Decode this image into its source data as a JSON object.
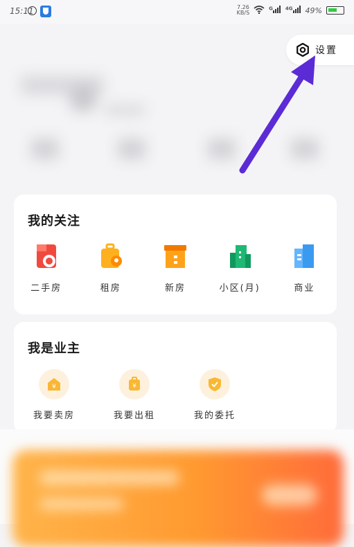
{
  "status_bar": {
    "time": "15:11",
    "net_speed_value": "7.26",
    "net_speed_unit": "KB/S",
    "signal1_label": "G",
    "signal2_label": "4G",
    "battery": "49%"
  },
  "settings": {
    "label": "设置"
  },
  "follow_card": {
    "title": "我的关注",
    "items": [
      {
        "label": "二手房",
        "icon": "second-hand-house-icon",
        "color": "#f04a3e"
      },
      {
        "label": "租房",
        "icon": "rent-luggage-icon",
        "color": "#ffb020"
      },
      {
        "label": "新房",
        "icon": "new-house-box-icon",
        "color": "#ffa21a"
      },
      {
        "label": "小区(月)",
        "icon": "community-building-icon",
        "color": "#1fb874"
      },
      {
        "label": "商业",
        "icon": "commercial-building-icon",
        "color": "#3a9af0"
      }
    ]
  },
  "owner_card": {
    "title": "我是业主",
    "items": [
      {
        "label": "我要卖房",
        "icon": "sell-house-icon"
      },
      {
        "label": "我要出租",
        "icon": "rent-out-icon"
      },
      {
        "label": "我的委托",
        "icon": "entrust-shield-icon"
      }
    ]
  },
  "colors": {
    "accent_arrow": "#5b2bd6",
    "owner_icon": "#f9b733",
    "owner_icon_bg": "#fdf1de",
    "banner": "#ff9a30"
  }
}
